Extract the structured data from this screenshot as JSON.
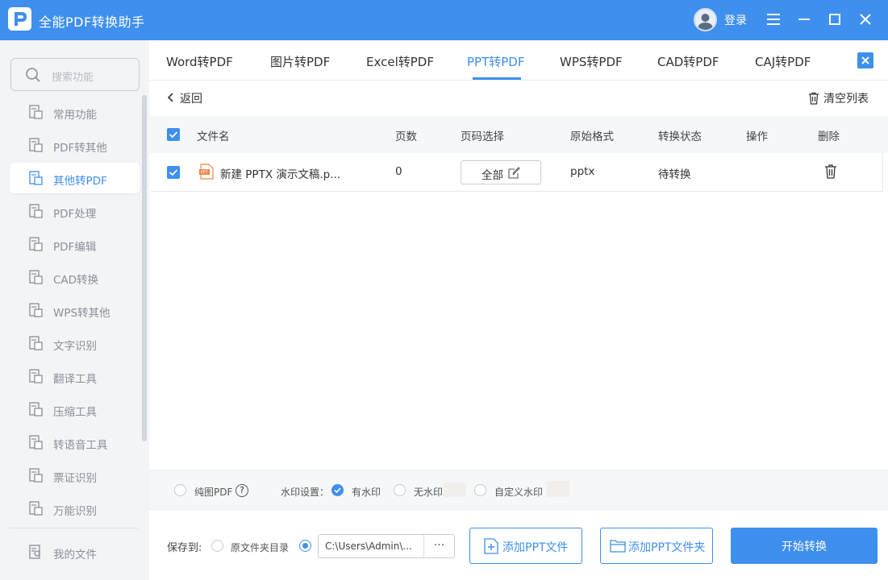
{
  "app": {
    "title": "全能PDF转换助手",
    "login_label": "登录"
  },
  "colors": {
    "accent": "#3e8fee",
    "sidebar_bg": "#f3f4f6",
    "text_muted": "#8a8f98"
  },
  "sidebar": {
    "search_placeholder": "搜索功能",
    "items": [
      {
        "label": "常用功能",
        "icon": "star-doc-icon",
        "active": false
      },
      {
        "label": "PDF转其他",
        "icon": "pdf-convert-icon",
        "active": false
      },
      {
        "label": "其他转PDF",
        "icon": "to-pdf-icon",
        "active": true
      },
      {
        "label": "PDF处理",
        "icon": "pdf-process-icon",
        "active": false
      },
      {
        "label": "PDF编辑",
        "icon": "pdf-edit-icon",
        "active": false
      },
      {
        "label": "CAD转换",
        "icon": "cad-icon",
        "active": false
      },
      {
        "label": "WPS转其他",
        "icon": "wps-icon",
        "active": false
      },
      {
        "label": "文字识别",
        "icon": "ocr-icon",
        "active": false
      },
      {
        "label": "翻译工具",
        "icon": "translate-icon",
        "active": false
      },
      {
        "label": "压缩工具",
        "icon": "compress-icon",
        "active": false
      },
      {
        "label": "转语音工具",
        "icon": "voice-icon",
        "active": false
      },
      {
        "label": "票证识别",
        "icon": "ticket-icon",
        "active": false
      },
      {
        "label": "万能识别",
        "icon": "scan-icon",
        "active": false
      }
    ],
    "footer_item": {
      "label": "我的文件",
      "icon": "my-files-icon"
    }
  },
  "tabs": [
    {
      "label": "Word转PDF",
      "active": false
    },
    {
      "label": "图片转PDF",
      "active": false
    },
    {
      "label": "Excel转PDF",
      "active": false
    },
    {
      "label": "PPT转PDF",
      "active": true
    },
    {
      "label": "WPS转PDF",
      "active": false
    },
    {
      "label": "CAD转PDF",
      "active": false
    },
    {
      "label": "CAJ转PDF",
      "active": false
    }
  ],
  "toolbar": {
    "back_label": "返回",
    "clear_label": "清空列表"
  },
  "table": {
    "columns": [
      "文件名",
      "页数",
      "页码选择",
      "原始格式",
      "转换状态",
      "操作",
      "删除"
    ],
    "rows": [
      {
        "file_name": "新建 PPTX 演示文稿.p...",
        "pages": "0",
        "page_select": "全部",
        "format": "pptx",
        "status": "待转换",
        "file_icon": "ppt-file-icon",
        "checked": true
      }
    ]
  },
  "options": {
    "pure_image_label": "纯图PDF",
    "watermark_label": "水印设置：",
    "with_watermark": "有水印",
    "no_watermark": "无水印",
    "custom_watermark": "自定义水印",
    "selected_watermark": "有水印"
  },
  "output": {
    "save_to_label": "保存到:",
    "source_folder_label": "原文件夹目录",
    "path_value": "C:\\Users\\Admin\\...",
    "browse_label": "···",
    "selected": "custom_path"
  },
  "actions": {
    "add_files": "添加PPT文件",
    "add_folder": "添加PPT文件夹",
    "start": "开始转换"
  }
}
